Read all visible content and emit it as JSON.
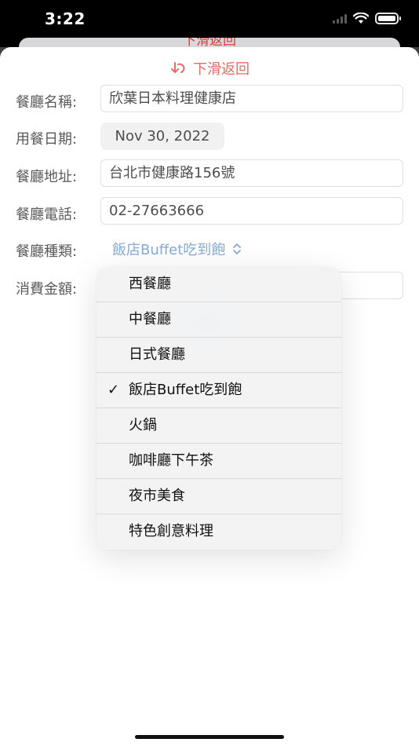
{
  "status_bar": {
    "time": "3:22"
  },
  "back_sheet": {
    "title": "下滑返回"
  },
  "sheet": {
    "dismiss_label": "下滑返回",
    "fields": {
      "name": {
        "label": "餐廳名稱:",
        "value": "欣葉日本料理健康店"
      },
      "date": {
        "label": "用餐日期:",
        "value": "Nov 30, 2022"
      },
      "address": {
        "label": "餐廳地址:",
        "value": "台北市健康路156號"
      },
      "phone": {
        "label": "餐廳電話:",
        "value": "02-27663666"
      },
      "type": {
        "label": "餐廳種類:",
        "value": "飯店Buffet吃到飽"
      },
      "amount": {
        "label": "消費金額:",
        "value": ""
      }
    }
  },
  "menu": {
    "items": [
      {
        "label": "西餐廳",
        "selected": false
      },
      {
        "label": "中餐廳",
        "selected": false
      },
      {
        "label": "日式餐廳",
        "selected": false
      },
      {
        "label": "飯店Buffet吃到飽",
        "selected": true
      },
      {
        "label": "火鍋",
        "selected": false
      },
      {
        "label": "咖啡廳下午茶",
        "selected": false
      },
      {
        "label": "夜市美食",
        "selected": false
      },
      {
        "label": "特色創意料理",
        "selected": false
      }
    ],
    "check_glyph": "✓"
  },
  "colors": {
    "accent_red": "#e23a31",
    "link_blue": "#5a8fc8"
  }
}
